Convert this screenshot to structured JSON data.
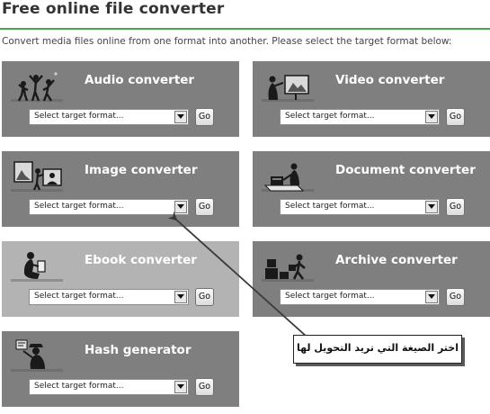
{
  "page": {
    "title": "Free online file converter",
    "subtitle": "Convert media files online from one format into another. Please select the target format below:",
    "accent_color": "#4aa64a"
  },
  "converters": [
    {
      "title": "Audio converter",
      "icon": "dancers-icon",
      "select_value": "Select target format...",
      "go_label": "Go"
    },
    {
      "title": "Video converter",
      "icon": "video-viewer-icon",
      "select_value": "Select target format...",
      "go_label": "Go"
    },
    {
      "title": "Image converter",
      "icon": "picture-frames-icon",
      "select_value": "Select target format...",
      "go_label": "Go"
    },
    {
      "title": "Document converter",
      "icon": "typing-person-icon",
      "select_value": "Select target format...",
      "go_label": "Go"
    },
    {
      "title": "Ebook converter",
      "icon": "reader-icon",
      "select_value": "Select target format...",
      "go_label": "Go",
      "highlighted": true
    },
    {
      "title": "Archive converter",
      "icon": "boxes-person-icon",
      "select_value": "Select target format...",
      "go_label": "Go"
    },
    {
      "title": "Hash generator",
      "icon": "detective-icon",
      "select_value": "Select target format...",
      "go_label": "Go"
    }
  ],
  "annotation": {
    "text": "اختر الصيغة التي تريد التحويل لها",
    "points_to": "image-converter-format-select"
  },
  "colors": {
    "card_background": "#7f7f7f",
    "card_highlighted": "#b3b3b3",
    "card_title": "#ffffff"
  }
}
